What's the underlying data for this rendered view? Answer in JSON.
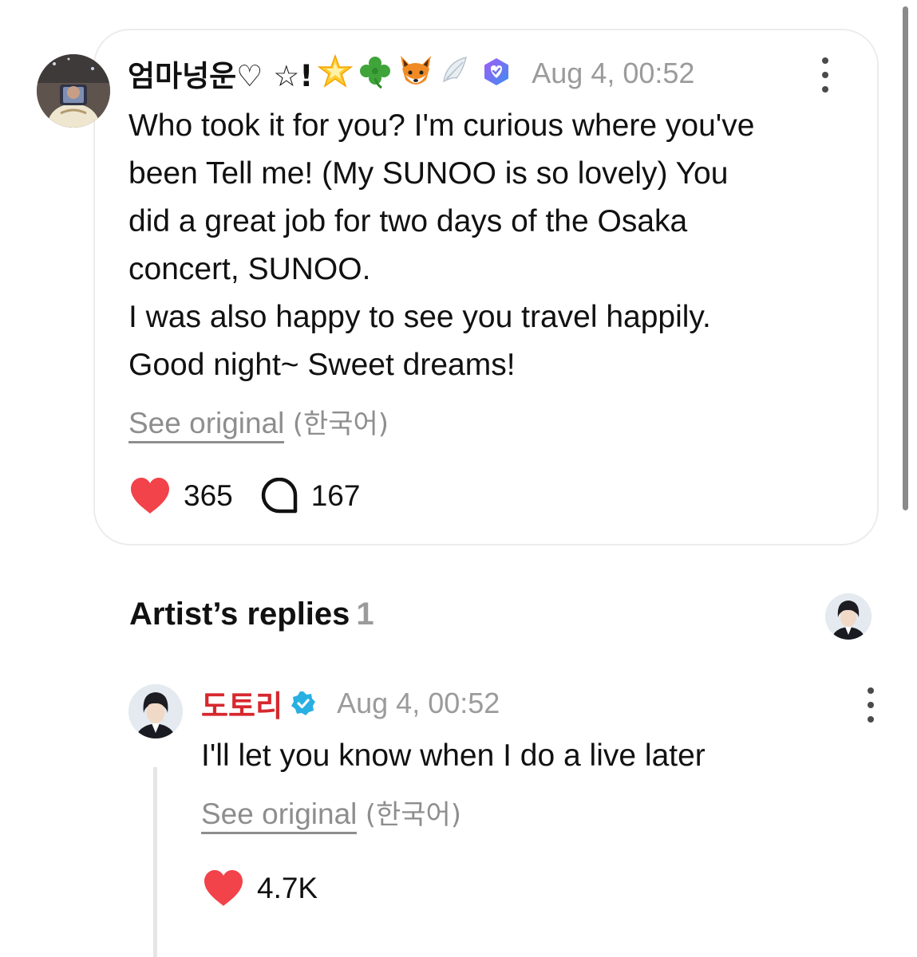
{
  "post": {
    "author": "엄마넝운♡ ☆!",
    "timestamp": "Aug 4, 00:52",
    "body_lines": [
      "Who took it for you? I'm curious where you've",
      "been Tell me! (My SUNOO is so lovely) You",
      "did a great job for two days of the Osaka",
      "concert, SUNOO.",
      "I was also happy to see you travel happily.",
      "Good night~ Sweet dreams!"
    ],
    "see_original": "See original",
    "original_language": "(한국어)",
    "likes": "365",
    "comments": "167",
    "icons": [
      "star-emoji-icon",
      "clover-emoji-icon",
      "fox-emoji-icon",
      "wing-emoji-icon",
      "membership-badge-icon",
      "more-icon",
      "heart-icon",
      "comment-icon"
    ]
  },
  "artist_replies": {
    "title": "Artist’s replies",
    "count": "1"
  },
  "reply": {
    "author": "도토리",
    "timestamp": "Aug 4, 00:52",
    "body": "I'll let you know when I do a live later",
    "see_original": "See original",
    "original_language": "(한국어)",
    "likes": "4.7K",
    "icons": [
      "verified-icon",
      "more-icon",
      "heart-icon"
    ]
  },
  "colors": {
    "heart": "#f2434a",
    "artist_name": "#d6282e",
    "verified": "#29b0e3",
    "muted_text": "#9b9b9b"
  }
}
